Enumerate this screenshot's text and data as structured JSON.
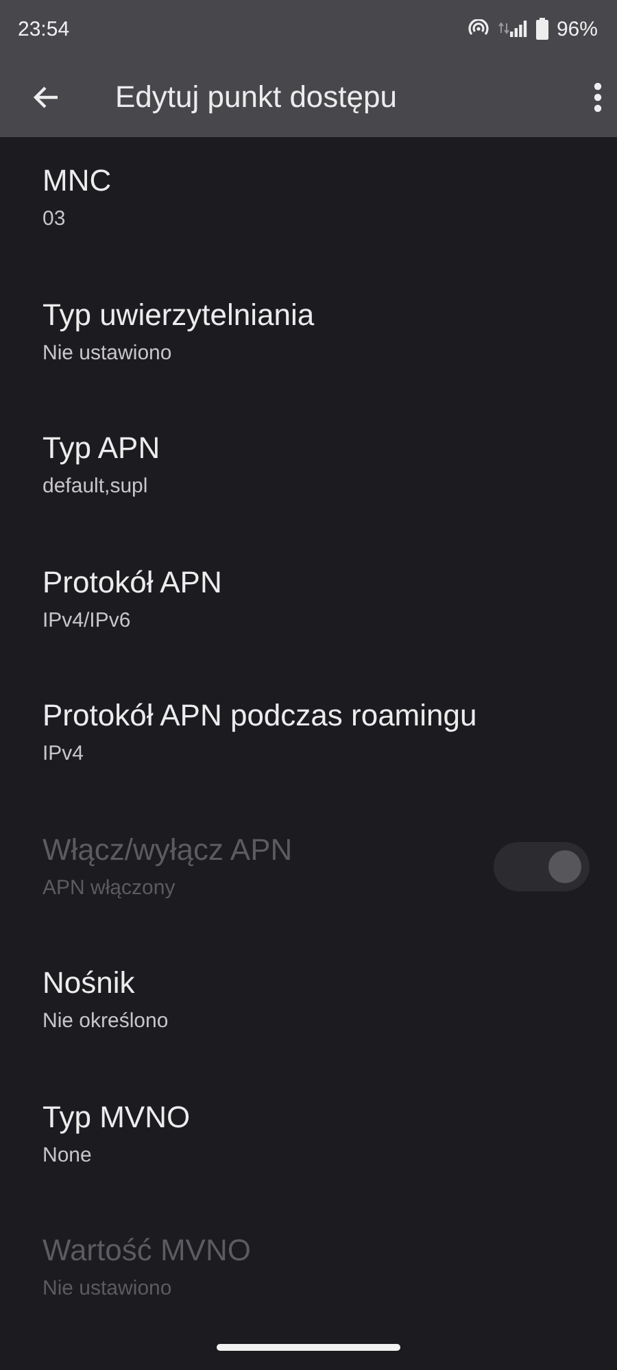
{
  "status_bar": {
    "time": "23:54",
    "battery": "96%"
  },
  "app_bar": {
    "title": "Edytuj punkt dostępu"
  },
  "settings": [
    {
      "kind": "text",
      "title": "MNC",
      "summary": "03",
      "disabled": false
    },
    {
      "kind": "text",
      "title": "Typ uwierzytelniania",
      "summary": "Nie ustawiono",
      "disabled": false
    },
    {
      "kind": "text",
      "title": "Typ APN",
      "summary": "default,supl",
      "disabled": false
    },
    {
      "kind": "text",
      "title": "Protokół APN",
      "summary": "IPv4/IPv6",
      "disabled": false
    },
    {
      "kind": "text",
      "title": "Protokół APN podczas roamingu",
      "summary": "IPv4",
      "disabled": false
    },
    {
      "kind": "toggle",
      "title": "Włącz/wyłącz APN",
      "summary": "APN włączony",
      "disabled": true,
      "on": true
    },
    {
      "kind": "text",
      "title": "Nośnik",
      "summary": "Nie określono",
      "disabled": false
    },
    {
      "kind": "text",
      "title": "Typ MVNO",
      "summary": "None",
      "disabled": false
    },
    {
      "kind": "text",
      "title": "Wartość MVNO",
      "summary": "Nie ustawiono",
      "disabled": true
    }
  ]
}
